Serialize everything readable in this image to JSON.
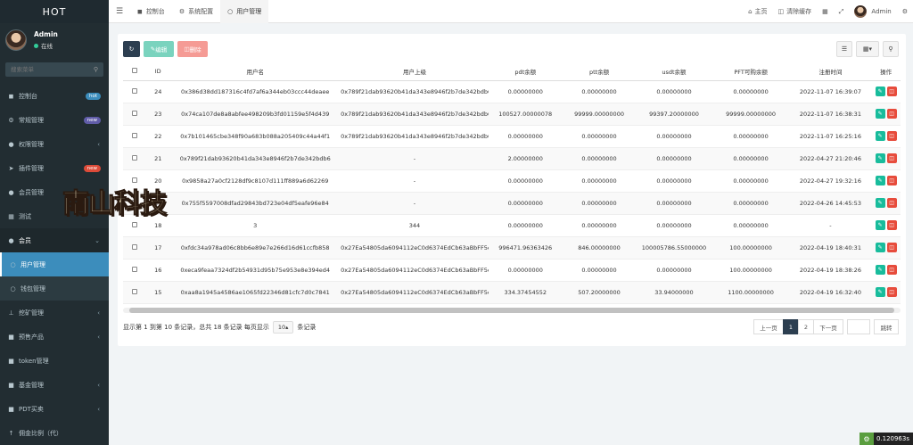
{
  "sidebar": {
    "logo": "HOT",
    "user_name": "Admin",
    "user_status": "在线",
    "search_placeholder": "搜索菜单",
    "items": [
      {
        "label": "控制台",
        "icon": "dashboard-icon",
        "badge": "hot",
        "badge_color": "#3c8dbc"
      },
      {
        "label": "常规管理",
        "icon": "gear-icon",
        "badge": "new",
        "badge_color": "#605ca8"
      },
      {
        "label": "权限管理",
        "icon": "group-icon"
      },
      {
        "label": "插件管理",
        "icon": "rocket-icon",
        "badge": "new",
        "badge_color": "#dd4b39"
      },
      {
        "label": "会员管理",
        "icon": "user-icon"
      },
      {
        "label": "测试",
        "icon": "table-icon"
      },
      {
        "label": "会员",
        "icon": "user-circle-icon"
      },
      {
        "label": "用户管理",
        "icon": "circle-icon"
      },
      {
        "label": "钱包管理",
        "icon": "circle-icon"
      },
      {
        "label": "挖矿管理",
        "icon": "pickaxe-icon"
      },
      {
        "label": "预售产品",
        "icon": "product-icon"
      },
      {
        "label": "token管理",
        "icon": "token-icon"
      },
      {
        "label": "基金管理",
        "icon": "fund-icon"
      },
      {
        "label": "PDT买卖",
        "icon": "trade-icon"
      },
      {
        "label": "佣金比例（代）",
        "icon": "percent-icon"
      }
    ]
  },
  "header": {
    "tabs": [
      {
        "label": "控制台",
        "icon": "dashboard-icon"
      },
      {
        "label": "系统配置",
        "icon": "gear-icon"
      },
      {
        "label": "用户管理",
        "icon": "circle-icon"
      }
    ],
    "right": {
      "home": "主页",
      "clear_cache": "清除缓存",
      "admin": "Admin"
    }
  },
  "toolbar": {
    "edit": "编辑",
    "delete": "删除"
  },
  "table": {
    "columns": [
      "ID",
      "用户名",
      "用户上级",
      "pdt余额",
      "ptt余额",
      "usdt余额",
      "PFT可购余额",
      "注册时间",
      "操作"
    ],
    "rows": [
      {
        "id": "24",
        "username": "0x386d38dd187316c4fd7af6a344eb03ccc44deaee",
        "parent": "0x789f21dab93620b41da343e8946f2b7de342bdb6",
        "pdt": "0.00000000",
        "ptt": "0.00000000",
        "usdt": "0.00000000",
        "pft": "0.00000000",
        "reg_time": "2022-11-07 16:39:07"
      },
      {
        "id": "23",
        "username": "0x74ca107de8a8abfee498209b3fd01159e5f4d439",
        "parent": "0x789f21dab93620b41da343e8946f2b7de342bdb6",
        "pdt": "100527.00000078",
        "ptt": "99999.00000000",
        "usdt": "99397.20000000",
        "pft": "99999.00000000",
        "reg_time": "2022-11-07 16:38:31"
      },
      {
        "id": "22",
        "username": "0x7b101465cbe348f90a683b088a205409c44a44f1",
        "parent": "0x789f21dab93620b41da343e8946f2b7de342bdb6",
        "pdt": "0.00000000",
        "ptt": "0.00000000",
        "usdt": "0.00000000",
        "pft": "0.00000000",
        "reg_time": "2022-11-07 16:25:16"
      },
      {
        "id": "21",
        "username": "0x789f21dab93620b41da343e8946f2b7de342bdb6",
        "parent": "-",
        "pdt": "2.00000000",
        "ptt": "0.00000000",
        "usdt": "0.00000000",
        "pft": "0.00000000",
        "reg_time": "2022-04-27 21:20:46"
      },
      {
        "id": "20",
        "username": "0x9858a27a0cf2128df9c8107d111ff889a6d62269",
        "parent": "-",
        "pdt": "0.00000000",
        "ptt": "0.00000000",
        "usdt": "0.00000000",
        "pft": "0.00000000",
        "reg_time": "2022-04-27 19:32:16"
      },
      {
        "id": "19",
        "username": "0x755f5597008dfad29843bd723e04df5eafe96e84",
        "parent": "-",
        "pdt": "0.00000000",
        "ptt": "0.00000000",
        "usdt": "0.00000000",
        "pft": "0.00000000",
        "reg_time": "2022-04-26 14:45:53"
      },
      {
        "id": "18",
        "username": "3",
        "parent": "344",
        "pdt": "0.00000000",
        "ptt": "0.00000000",
        "usdt": "0.00000000",
        "pft": "0.00000000",
        "reg_time": "-"
      },
      {
        "id": "17",
        "username": "0xfdc34a978ad06c8bb6e89e7e266d16d61ccfb858",
        "parent": "0x27Ea54805da6094112eC0d6374EdCb63aBbFF5e2",
        "pdt": "996471.96363426",
        "ptt": "846.00000000",
        "usdt": "100005786.55000000",
        "pft": "100.00000000",
        "reg_time": "2022-04-19 18:40:31"
      },
      {
        "id": "16",
        "username": "0xeca9feaa7324df2b54931d95b75e953e8e394ed4",
        "parent": "0x27Ea54805da6094112eC0d6374EdCb63aBbFF5e2",
        "pdt": "0.00000000",
        "ptt": "0.00000000",
        "usdt": "0.00000000",
        "pft": "100.00000000",
        "reg_time": "2022-04-19 18:38:26"
      },
      {
        "id": "15",
        "username": "0xaa8a1945a4586ae1065fd22346d81cfc7d0c7841",
        "parent": "0x27Ea54805da6094112eC0d6374EdCb63aBbFF5e2",
        "pdt": "334.37454552",
        "ptt": "507.20000000",
        "usdt": "33.94000000",
        "pft": "1100.00000000",
        "reg_time": "2022-04-19 16:32:40"
      }
    ]
  },
  "footer": {
    "summary": "显示第 1 到第 10 条记录，总共 18 条记录 每页显示",
    "page_size": "10",
    "summary_suffix": "条记录",
    "prev": "上一页",
    "pages": [
      "1",
      "2"
    ],
    "next": "下一页",
    "jump": "跳转"
  },
  "watermark": "南山科技",
  "timer": "0.120963s"
}
